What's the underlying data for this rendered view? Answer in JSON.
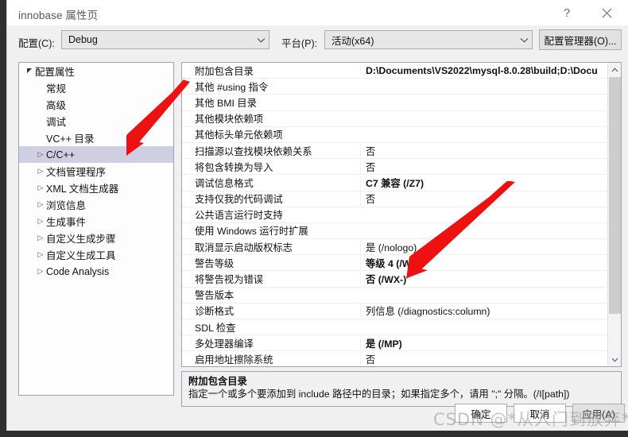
{
  "window": {
    "title": "innobase 属性页",
    "help_icon": "?",
    "close_icon": "close-icon"
  },
  "configbar": {
    "config_label": "配置(C):",
    "config_value": "Debug",
    "platform_label": "平台(P):",
    "platform_value": "活动(x64)",
    "config_manager_button": "配置管理器(O)..."
  },
  "tree": {
    "items": [
      {
        "label": "配置属性",
        "indent": 0,
        "twisty": "expanded",
        "selected": false
      },
      {
        "label": "常规",
        "indent": 1,
        "twisty": "none",
        "selected": false
      },
      {
        "label": "高级",
        "indent": 1,
        "twisty": "none",
        "selected": false
      },
      {
        "label": "调试",
        "indent": 1,
        "twisty": "none",
        "selected": false
      },
      {
        "label": "VC++ 目录",
        "indent": 1,
        "twisty": "none",
        "selected": false
      },
      {
        "label": "C/C++",
        "indent": 1,
        "twisty": "collapsed",
        "selected": true
      },
      {
        "label": "文档管理程序",
        "indent": 1,
        "twisty": "collapsed",
        "selected": false
      },
      {
        "label": "XML 文档生成器",
        "indent": 1,
        "twisty": "collapsed",
        "selected": false
      },
      {
        "label": "浏览信息",
        "indent": 1,
        "twisty": "collapsed",
        "selected": false
      },
      {
        "label": "生成事件",
        "indent": 1,
        "twisty": "collapsed",
        "selected": false
      },
      {
        "label": "自定义生成步骤",
        "indent": 1,
        "twisty": "collapsed",
        "selected": false
      },
      {
        "label": "自定义生成工具",
        "indent": 1,
        "twisty": "collapsed",
        "selected": false
      },
      {
        "label": "Code Analysis",
        "indent": 1,
        "twisty": "collapsed",
        "selected": false
      }
    ]
  },
  "grid": {
    "rows": [
      {
        "name": "附加包含目录",
        "value": "D:\\Documents\\VS2022\\mysql-8.0.28\\build;D:\\Docu",
        "bold": true
      },
      {
        "name": "其他 #using 指令",
        "value": "",
        "bold": false
      },
      {
        "name": "其他 BMI 目录",
        "value": "",
        "bold": false
      },
      {
        "name": "其他模块依赖项",
        "value": "",
        "bold": false
      },
      {
        "name": "其他标头单元依赖项",
        "value": "",
        "bold": false
      },
      {
        "name": "扫描源以查找模块依赖关系",
        "value": "否",
        "bold": false
      },
      {
        "name": "将包含转换为导入",
        "value": "否",
        "bold": false
      },
      {
        "name": "调试信息格式",
        "value": "C7 兼容 (/Z7)",
        "bold": true
      },
      {
        "name": "支持仅我的代码调试",
        "value": "否",
        "bold": false
      },
      {
        "name": "公共语言运行时支持",
        "value": "",
        "bold": false
      },
      {
        "name": "使用 Windows 运行时扩展",
        "value": "",
        "bold": false
      },
      {
        "name": "取消显示启动版权标志",
        "value": "是 (/nologo)",
        "bold": false
      },
      {
        "name": "警告等级",
        "value": "等级 4 (/W4)",
        "bold": true
      },
      {
        "name": "将警告视为错误",
        "value": "否 (/WX-)",
        "bold": true
      },
      {
        "name": "警告版本",
        "value": "",
        "bold": false
      },
      {
        "name": "诊断格式",
        "value": "列信息 (/diagnostics:column)",
        "bold": false
      },
      {
        "name": "SDL 检查",
        "value": "",
        "bold": false
      },
      {
        "name": "多处理器编译",
        "value": "是 (/MP)",
        "bold": true
      },
      {
        "name": "启用地址擦除系统",
        "value": "否",
        "bold": false
      }
    ],
    "scroll_up_icon": "chevron-up-icon",
    "scroll_down_icon": "chevron-down-icon"
  },
  "description": {
    "title": "附加包含目录",
    "body": "指定一个或多个要添加到 include 路径中的目录；如果指定多个，请用 \";\" 分隔。(/I[path])"
  },
  "footer": {
    "ok": "确定",
    "cancel": "取消",
    "apply": "应用(A)"
  },
  "watermark": {
    "text": "CSDN @*从入门到放弃*"
  },
  "annotations": {
    "arrow_color": "#ee1111",
    "arrow_1_target": "C/C++",
    "arrow_2_target": "将警告视为错误"
  }
}
